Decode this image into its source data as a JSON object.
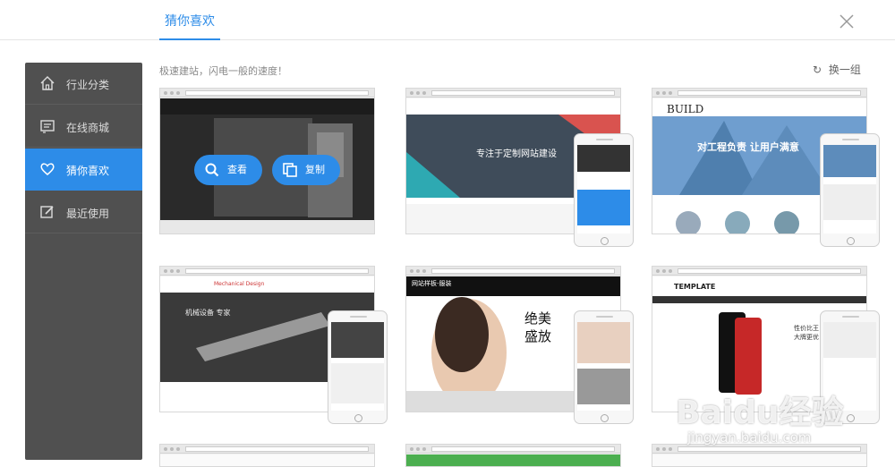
{
  "header": {
    "tab_label": "猜你喜欢"
  },
  "sidebar": {
    "items": [
      {
        "label": "行业分类",
        "icon": "home-icon"
      },
      {
        "label": "在线商城",
        "icon": "store-icon"
      },
      {
        "label": "猜你喜欢",
        "icon": "heart-icon"
      },
      {
        "label": "最近使用",
        "icon": "edit-icon"
      }
    ]
  },
  "main": {
    "subtitle": "极速建站，闪电一般的速度！",
    "refresh_label": "换一组",
    "hover": {
      "view_label": "查看",
      "copy_label": "复制"
    },
    "templates": [
      {
        "kind": "dark-photo",
        "text_a": "",
        "text_b": ""
      },
      {
        "kind": "geo",
        "text_a": "专注于定制网站建设",
        "text_b": ""
      },
      {
        "kind": "build",
        "text_a": "BUILD",
        "text_b": "对工程负责  让用户满意"
      },
      {
        "kind": "mech",
        "text_a": "Mechanical Design",
        "text_b": "机械设备 专家"
      },
      {
        "kind": "fashion",
        "text_a": "网站样板-服装",
        "text_b": "绝美盛放"
      },
      {
        "kind": "phones",
        "text_a": "TEMPLATE",
        "text_b": "性价比王 比大牌更优"
      }
    ]
  },
  "watermark": {
    "logo": "Baidu经验",
    "url": "jingyan.baidu.com"
  },
  "colors": {
    "accent": "#2d8ce8",
    "sidebar": "#505050"
  }
}
